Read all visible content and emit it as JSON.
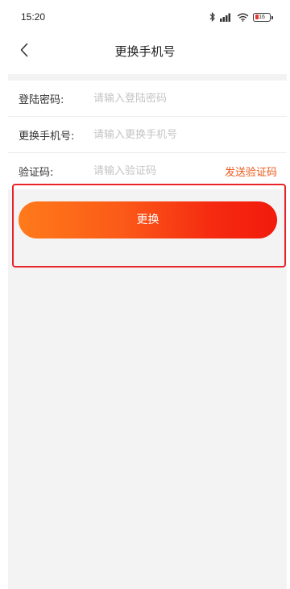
{
  "status_bar": {
    "time": "15:20",
    "battery": "16",
    "icons": [
      "bluetooth-icon",
      "signal-icon",
      "wifi-icon",
      "battery-icon"
    ]
  },
  "nav": {
    "back_icon": "chevron-left-icon",
    "title": "更换手机号"
  },
  "form": {
    "password": {
      "label": "登陆密码:",
      "placeholder": "请输入登陆密码",
      "value": ""
    },
    "new_phone": {
      "label": "更换手机号:",
      "placeholder": "请输入更换手机号",
      "value": ""
    },
    "code": {
      "label": "验证码:",
      "placeholder": "请输入验证码",
      "value": "",
      "send_label": "发送验证码"
    }
  },
  "submit": {
    "label": "更换"
  },
  "colors": {
    "accent": "#e8591a",
    "button_gradient_start": "#ff7a1a",
    "button_gradient_end": "#f21a0c",
    "highlight": "#e8242a",
    "background": "#f3f3f3"
  }
}
